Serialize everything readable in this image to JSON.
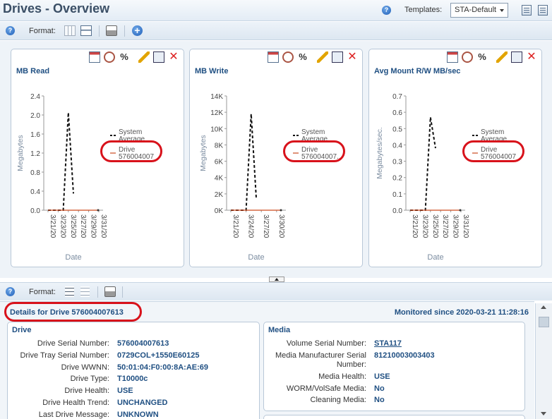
{
  "header": {
    "title": "Drives - Overview",
    "templates_label": "Templates:",
    "template_value": "STA-Default"
  },
  "toolbar": {
    "format_label": "Format:"
  },
  "toolbar2": {
    "format_label": "Format:"
  },
  "charts": [
    {
      "title": "MB Read",
      "ylabel": "Megabytes",
      "xlabel": "Date",
      "legend": [
        {
          "label": "System Average",
          "style": "dashed"
        },
        {
          "label": "Drive 576004007",
          "style": "solid"
        }
      ]
    },
    {
      "title": "MB Write",
      "ylabel": "Megabytes",
      "xlabel": "Date",
      "legend": [
        {
          "label": "System Average",
          "style": "dashed"
        },
        {
          "label": "Drive 576004007...",
          "style": "solid"
        }
      ]
    },
    {
      "title": "Avg Mount R/W MB/sec",
      "ylabel": "Megabytes/sec.",
      "xlabel": "Date",
      "legend": [
        {
          "label": "System Average",
          "style": "dashed"
        },
        {
          "label": "Drive 576004007",
          "style": "solid"
        }
      ]
    }
  ],
  "chart_data": [
    {
      "type": "line",
      "title": "MB Read",
      "xlabel": "Date",
      "ylabel": "Megabytes",
      "ylim": [
        0,
        2.4
      ],
      "yticks": [
        "0.0",
        "0.4",
        "0.8",
        "1.2",
        "1.6",
        "2.0",
        "2.4"
      ],
      "x_ticks": [
        "3/21/20",
        "3/23/20",
        "3/25/20",
        "3/27/20",
        "3/29/20",
        "3/31/20"
      ],
      "series": [
        {
          "name": "System Average",
          "x": [
            "3/21/20",
            "3/22/20",
            "3/23/20",
            "3/24/20",
            "3/25/20",
            "3/26/20"
          ],
          "values": [
            0,
            0,
            0,
            0,
            2.05,
            0.35
          ]
        },
        {
          "name": "Drive 576004007",
          "x": [
            "3/21/20",
            "3/31/20"
          ],
          "values": [
            0,
            0
          ]
        }
      ]
    },
    {
      "type": "line",
      "title": "MB Write",
      "xlabel": "Date",
      "ylabel": "Megabytes",
      "ylim": [
        0,
        14000
      ],
      "yticks": [
        "0K",
        "2K",
        "4K",
        "6K",
        "8K",
        "10K",
        "12K",
        "14K"
      ],
      "x_ticks": [
        "3/21/20",
        "3/24/20",
        "3/27/20",
        "3/30/20"
      ],
      "series": [
        {
          "name": "System Average",
          "x": [
            "3/21/20",
            "3/22/20",
            "3/23/20",
            "3/24/20",
            "3/25/20",
            "3/26/20"
          ],
          "values": [
            0,
            0,
            0,
            0,
            11800,
            1500
          ]
        },
        {
          "name": "Drive 576004007...",
          "x": [
            "3/21/20",
            "3/31/20"
          ],
          "values": [
            0,
            0
          ]
        }
      ]
    },
    {
      "type": "line",
      "title": "Avg Mount R/W MB/sec",
      "xlabel": "Date",
      "ylabel": "Megabytes/sec.",
      "ylim": [
        0,
        0.7
      ],
      "yticks": [
        "0.0",
        "0.1",
        "0.2",
        "0.3",
        "0.4",
        "0.5",
        "0.6",
        "0.7"
      ],
      "x_ticks": [
        "3/21/20",
        "3/23/20",
        "3/25/20",
        "3/27/20",
        "3/29/20",
        "3/31/20"
      ],
      "series": [
        {
          "name": "System Average",
          "x": [
            "3/21/20",
            "3/22/20",
            "3/23/20",
            "3/24/20",
            "3/25/20",
            "3/26/20"
          ],
          "values": [
            0,
            0,
            0,
            0,
            0.57,
            0.38
          ]
        },
        {
          "name": "Drive 576004007",
          "x": [
            "3/21/20",
            "3/31/20"
          ],
          "values": [
            0,
            0
          ]
        }
      ]
    }
  ],
  "details": {
    "title": "Details for Drive 576004007613",
    "monitored": "Monitored since 2020-03-21 11:28:16",
    "drive": {
      "heading": "Drive",
      "rows": [
        {
          "label": "Drive Serial Number:",
          "value": "576004007613"
        },
        {
          "label": "Drive Tray Serial Number:",
          "value": "0729COL+1550E60125"
        },
        {
          "label": "Drive WWNN:",
          "value": "50:01:04:F0:00:8A:AE:69"
        },
        {
          "label": "Drive Type:",
          "value": "T10000c"
        },
        {
          "label": "Drive Health:",
          "value": "USE"
        },
        {
          "label": "Drive Health Trend:",
          "value": "UNCHANGED"
        },
        {
          "label": "Last Drive Message:",
          "value": "UNKNOWN"
        }
      ]
    },
    "media": {
      "heading": "Media",
      "rows": [
        {
          "label": "Volume Serial Number:",
          "value": "STA117"
        },
        {
          "label": "Media Manufacturer Serial Number:",
          "value": "81210003003403"
        },
        {
          "label": "Media Health:",
          "value": "USE"
        },
        {
          "label": "WORM/VolSafe Media:",
          "value": "No"
        },
        {
          "label": "Cleaning Media:",
          "value": "No"
        }
      ]
    }
  },
  "colors": {
    "accent": "#1f4f82",
    "callout": "#d8121b",
    "drive_line": "#cc4a1f"
  }
}
